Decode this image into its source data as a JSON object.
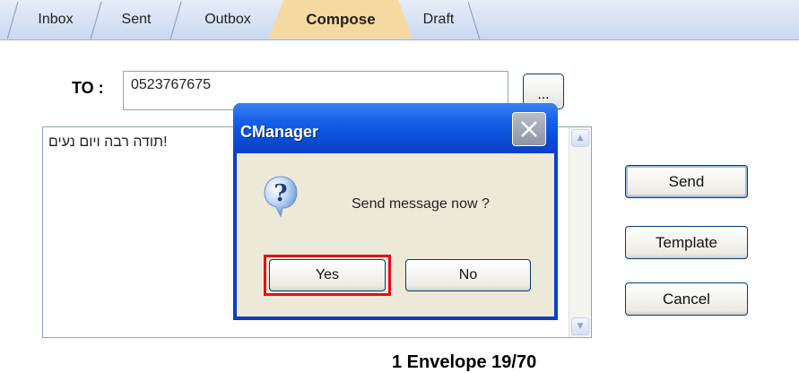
{
  "tabs": [
    {
      "label": "Inbox",
      "active": false
    },
    {
      "label": "Sent",
      "active": false
    },
    {
      "label": "Outbox",
      "active": false
    },
    {
      "label": "Compose",
      "active": true
    },
    {
      "label": "Draft",
      "active": false
    }
  ],
  "compose": {
    "to_label": "TO :",
    "to_value": "0523767675",
    "browse_label": "...",
    "message_text": "!תודה רבה ויום נעים",
    "status": "1 Envelope  19/70"
  },
  "actions": {
    "send_label": "Send",
    "template_label": "Template",
    "cancel_label": "Cancel"
  },
  "dialog": {
    "title": "CManager",
    "message": "Send message now ?",
    "yes_label": "Yes",
    "no_label": "No",
    "icon": "question-icon",
    "highlight_color": "#e0111a"
  },
  "colors": {
    "active_tab": "#f6d9a0",
    "tab_bar": "#cad8f0",
    "dialog_title": "#0a4ed6",
    "dialog_body": "#ece9d8"
  }
}
